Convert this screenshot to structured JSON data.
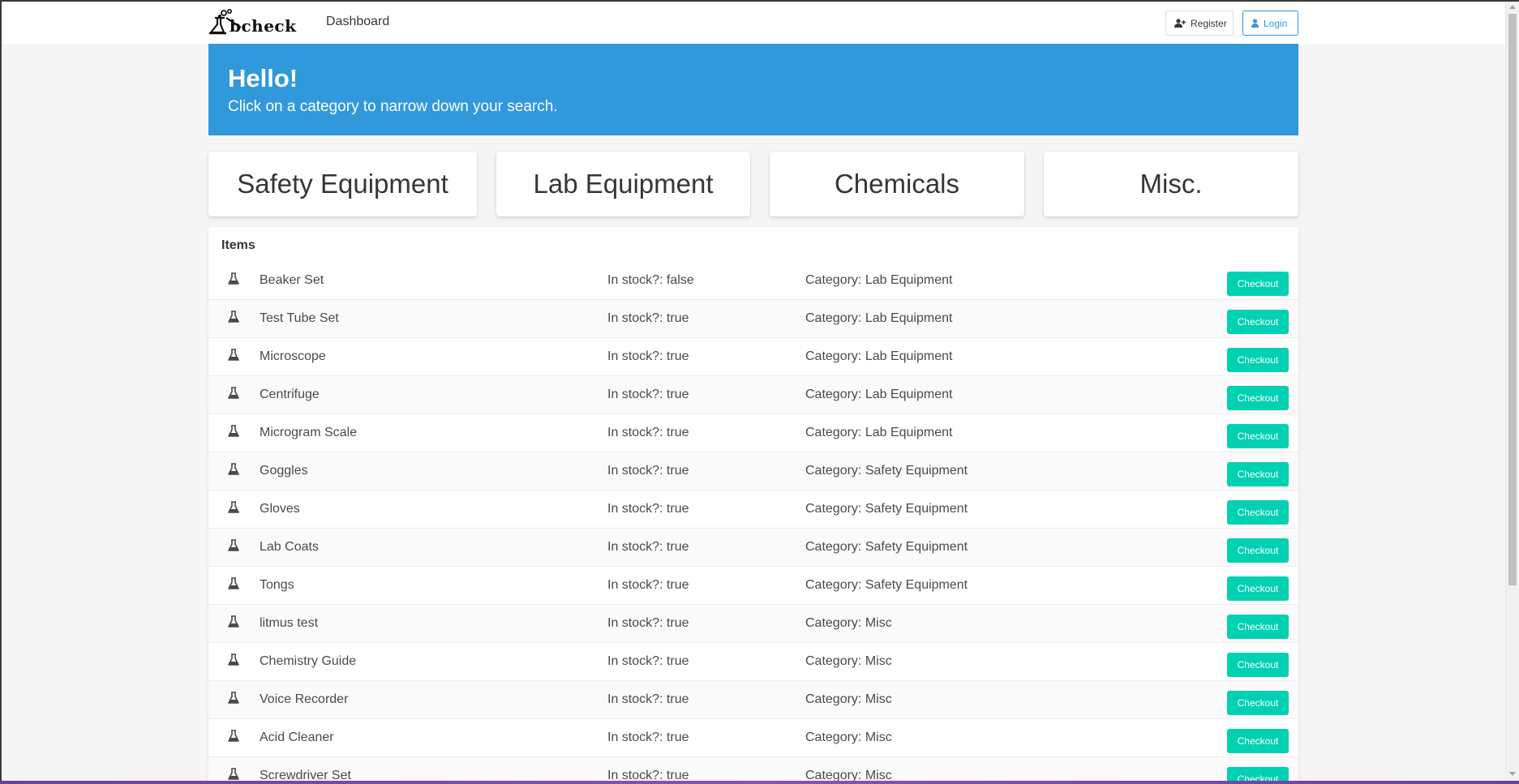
{
  "navbar": {
    "logo_text": "bcheck",
    "dashboard_label": "Dashboard",
    "register_label": "Register",
    "login_label": "Login"
  },
  "hero": {
    "title": "Hello!",
    "subtitle": "Click on a category to narrow down your search."
  },
  "categories": [
    {
      "label": "Safety Equipment"
    },
    {
      "label": "Lab Equipment"
    },
    {
      "label": "Chemicals"
    },
    {
      "label": "Misc."
    }
  ],
  "items_panel": {
    "heading": "Items",
    "checkout_label": "Checkout",
    "rows": [
      {
        "name": "Beaker Set",
        "stock": "In stock?: false",
        "category": "Category: Lab Equipment"
      },
      {
        "name": "Test Tube Set",
        "stock": "In stock?: true",
        "category": "Category: Lab Equipment"
      },
      {
        "name": "Microscope",
        "stock": "In stock?: true",
        "category": "Category: Lab Equipment"
      },
      {
        "name": "Centrifuge",
        "stock": "In stock?: true",
        "category": "Category: Lab Equipment"
      },
      {
        "name": "Microgram Scale",
        "stock": "In stock?: true",
        "category": "Category: Lab Equipment"
      },
      {
        "name": "Goggles",
        "stock": "In stock?: true",
        "category": "Category: Safety Equipment"
      },
      {
        "name": "Gloves",
        "stock": "In stock?: true",
        "category": "Category: Safety Equipment"
      },
      {
        "name": "Lab Coats",
        "stock": "In stock?: true",
        "category": "Category: Safety Equipment"
      },
      {
        "name": "Tongs",
        "stock": "In stock?: true",
        "category": "Category: Safety Equipment"
      },
      {
        "name": "litmus test",
        "stock": "In stock?: true",
        "category": "Category: Misc"
      },
      {
        "name": "Chemistry Guide",
        "stock": "In stock?: true",
        "category": "Category: Misc"
      },
      {
        "name": "Voice Recorder",
        "stock": "In stock?: true",
        "category": "Category: Misc"
      },
      {
        "name": "Acid Cleaner",
        "stock": "In stock?: true",
        "category": "Category: Misc"
      },
      {
        "name": "Screwdriver Set",
        "stock": "In stock?: true",
        "category": "Category: Misc"
      }
    ]
  },
  "icons": {
    "row_icon": "flask-icon",
    "register_icon": "user-plus-icon",
    "login_icon": "user-icon"
  },
  "colors": {
    "hero": "#3298dc",
    "checkout": "#00d1b2",
    "login_accent": "#3298dc"
  }
}
